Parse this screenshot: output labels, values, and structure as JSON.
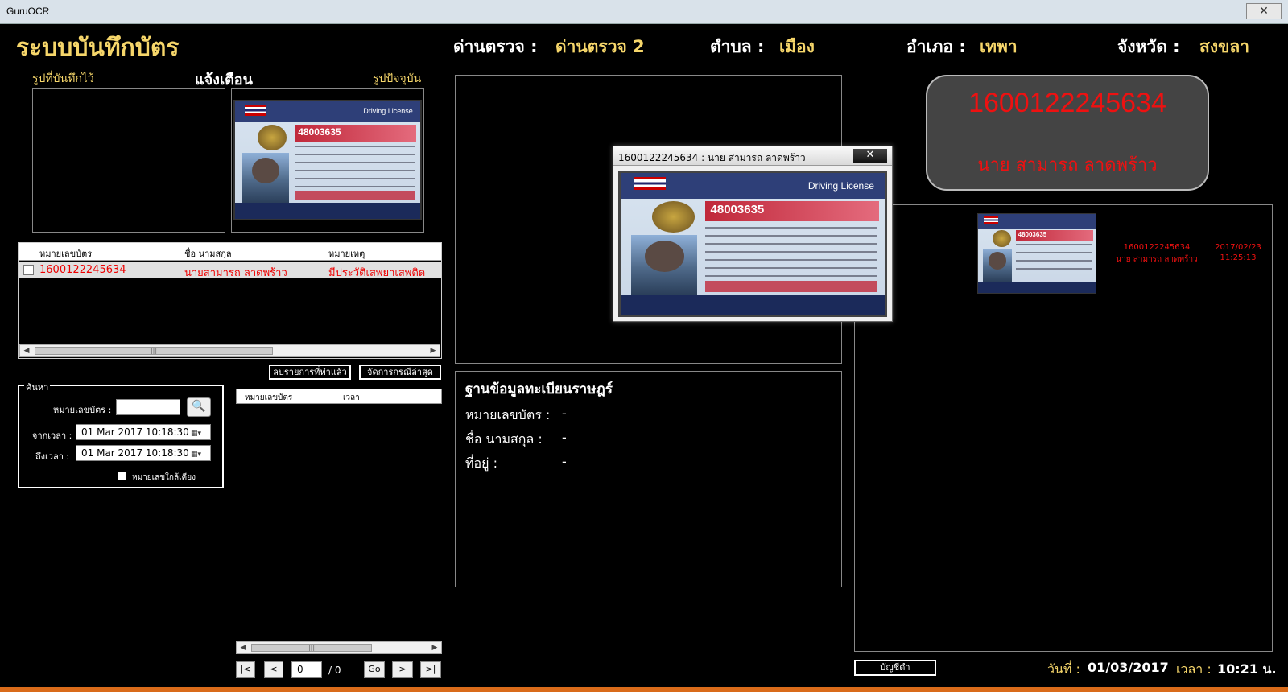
{
  "window": {
    "title": "GuruOCR",
    "close_label": "✕"
  },
  "header": {
    "app_title": "ระบบบันทึกบัตร",
    "checkpoint_label": "ด่านตรวจ :",
    "checkpoint_value": "ด่านตรวจ 2",
    "subdistrict_label": "ตำบล :",
    "subdistrict_value": "เมือง",
    "district_label": "อำเภอ :",
    "district_value": "เทพา",
    "province_label": "จังหวัด :",
    "province_value": "สงขลา"
  },
  "image_panels": {
    "saved_label": "รูปที่บันทึกไว้",
    "alert_label": "แจ้งเตือน",
    "current_label": "รูปปัจจุบัน"
  },
  "card": {
    "license_text": "Driving License",
    "number": "48003635"
  },
  "alert_table": {
    "columns": [
      "หมายเลขบัตร",
      "ชื่อ นามสกุล",
      "หมายเหตุ"
    ],
    "rows": [
      {
        "id": "1600122245634",
        "name": "นายสามารถ ลาดพร้าว",
        "note": "มีประวัติเสพยาเสพติด"
      }
    ]
  },
  "buttons": {
    "clear_done": "ลบรายการที่ทำแล้ว",
    "manage_latest": "จัดการกรณีล่าสุด",
    "blacklist": "บัญชีดำ"
  },
  "search": {
    "legend": "ค้นหา",
    "card_no_label": "หมายเลขบัตร :",
    "card_no_value": "",
    "from_label": "จากเวลา :",
    "from_value": "01 Mar 2017   10:18:30",
    "to_label": "ถึงเวลา :",
    "to_value": "01 Mar 2017   10:18:30",
    "similar_label": "หมายเลขใกล้เคียง"
  },
  "result_table": {
    "columns": [
      "หมายเลขบัตร",
      "เวลา"
    ]
  },
  "pager": {
    "first": "|<",
    "prev": "<",
    "page_value": "0",
    "total": "/ 0",
    "go": "Go",
    "next": ">",
    "last": ">|"
  },
  "registry": {
    "title": "ฐานข้อมูลทะเบียนราษฎร์",
    "id_label": "หมายเลขบัตร :",
    "id_value": "-",
    "name_label": "ชื่อ นามสกุล :",
    "name_value": "-",
    "address_label": "ที่อยู่ :",
    "address_value": "-"
  },
  "popup": {
    "title": "1600122245634 : นาย สามารถ ลาดพร้าว",
    "close": "✕"
  },
  "plate": {
    "number": "1600122245634",
    "name": "นาย สามารถ ลาดพร้าว"
  },
  "history": [
    {
      "id": "1600122245634",
      "name": "นาย สามารถ ลาดพร้าว",
      "date": "2017/02/23",
      "time": "11:25:13"
    }
  ],
  "footer": {
    "date_label": "วันที่ :",
    "date_value": "01/03/2017",
    "time_label": "เวลา :",
    "time_value": "10:21 น."
  }
}
